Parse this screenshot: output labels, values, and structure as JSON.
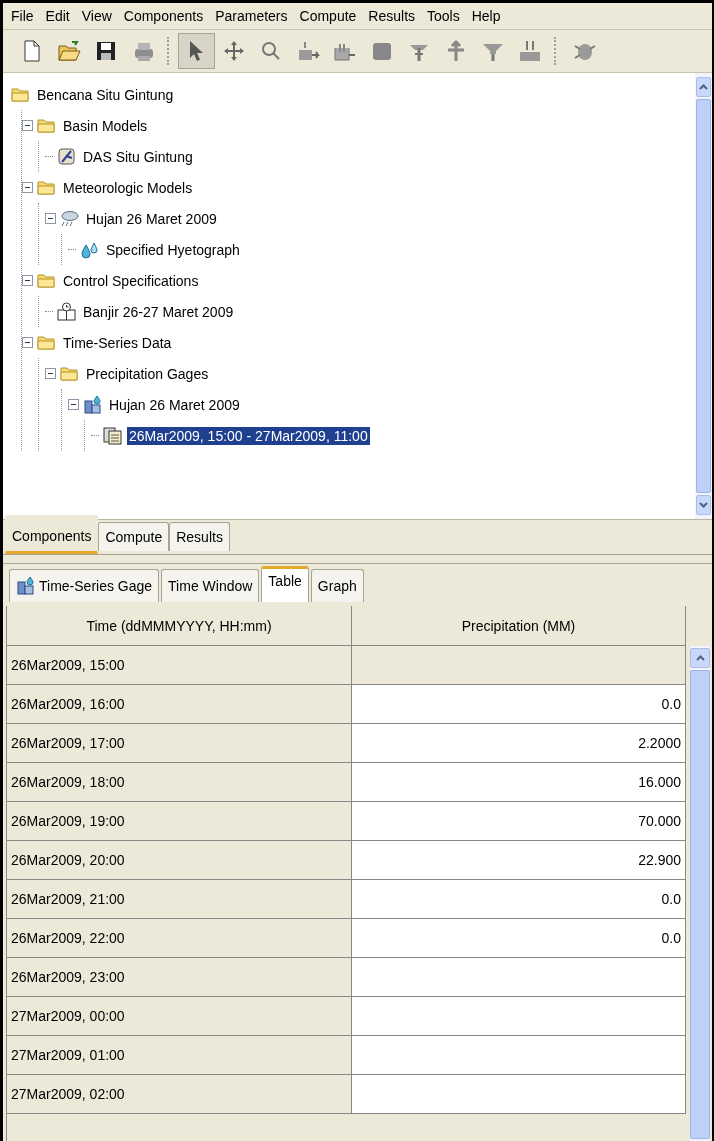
{
  "menu": [
    "File",
    "Edit",
    "View",
    "Components",
    "Parameters",
    "Compute",
    "Results",
    "Tools",
    "Help"
  ],
  "toolbar": {
    "groups": [
      [
        {
          "kind": "new",
          "selected": false
        },
        {
          "kind": "open",
          "selected": false
        },
        {
          "kind": "save",
          "selected": false
        },
        {
          "kind": "print",
          "selected": false
        }
      ],
      [
        {
          "kind": "select",
          "selected": true
        },
        {
          "kind": "move",
          "selected": false
        },
        {
          "kind": "zoom",
          "selected": false
        },
        {
          "kind": "source",
          "selected": false
        },
        {
          "kind": "inflow",
          "selected": false
        },
        {
          "kind": "reservoir",
          "selected": false
        },
        {
          "kind": "split",
          "selected": false
        },
        {
          "kind": "diversion",
          "selected": false
        },
        {
          "kind": "funnel",
          "selected": false
        },
        {
          "kind": "sink",
          "selected": false
        }
      ],
      [
        {
          "kind": "bug",
          "selected": false
        }
      ]
    ]
  },
  "tree": {
    "label": "Bencana Situ Gintung",
    "kind": "folder",
    "selected": false,
    "children": [
      {
        "label": "Basin Models",
        "kind": "folder",
        "expanded": true,
        "selected": false,
        "children": [
          {
            "label": "DAS Situ Gintung",
            "kind": "basin",
            "selected": false
          }
        ]
      },
      {
        "label": "Meteorologic Models",
        "kind": "folder",
        "expanded": true,
        "selected": false,
        "children": [
          {
            "label": "Hujan 26 Maret 2009",
            "kind": "rain",
            "expanded": true,
            "selected": false,
            "children": [
              {
                "label": "Specified Hyetograph",
                "kind": "drops",
                "selected": false
              }
            ]
          }
        ]
      },
      {
        "label": "Control Specifications",
        "kind": "folder",
        "expanded": true,
        "selected": false,
        "children": [
          {
            "label": "Banjir 26-27 Maret 2009",
            "kind": "calendar",
            "selected": false
          }
        ]
      },
      {
        "label": "Time-Series Data",
        "kind": "folder",
        "expanded": true,
        "selected": false,
        "children": [
          {
            "label": "Precipitation Gages",
            "kind": "folder",
            "expanded": true,
            "selected": false,
            "children": [
              {
                "label": "Hujan 26 Maret 2009",
                "kind": "gage",
                "expanded": true,
                "selected": false,
                "children": [
                  {
                    "label": "26Mar2009, 15:00 - 27Mar2009, 11:00",
                    "kind": "sheet",
                    "selected": true
                  }
                ]
              }
            ]
          }
        ]
      }
    ]
  },
  "main_tabs": [
    {
      "label": "Components",
      "selected": true
    },
    {
      "label": "Compute",
      "selected": false
    },
    {
      "label": "Results",
      "selected": false
    }
  ],
  "sub_tabs": [
    {
      "label": "Time-Series Gage",
      "kind": "gage",
      "selected": false
    },
    {
      "label": "Time Window",
      "selected": false
    },
    {
      "label": "Table",
      "selected": true
    },
    {
      "label": "Graph",
      "selected": false
    }
  ],
  "table": {
    "columns": [
      "Time (ddMMMYYYY, HH:mm)",
      "Precipitation (MM)"
    ],
    "rows": [
      {
        "time": "26Mar2009, 15:00",
        "editable": false
      },
      {
        "time": "26Mar2009, 16:00",
        "value": "0.0",
        "editable": true
      },
      {
        "time": "26Mar2009, 17:00",
        "value": "2.2000",
        "editable": true
      },
      {
        "time": "26Mar2009, 18:00",
        "value": "16.000",
        "editable": true
      },
      {
        "time": "26Mar2009, 19:00",
        "value": "70.000",
        "editable": true
      },
      {
        "time": "26Mar2009, 20:00",
        "value": "22.900",
        "editable": true
      },
      {
        "time": "26Mar2009, 21:00",
        "value": "0.0",
        "editable": true
      },
      {
        "time": "26Mar2009, 22:00",
        "value": "0.0",
        "editable": true
      },
      {
        "time": "26Mar2009, 23:00",
        "editable": true
      },
      {
        "time": "27Mar2009, 00:00",
        "editable": true
      },
      {
        "time": "27Mar2009, 01:00",
        "editable": true
      },
      {
        "time": "27Mar2009, 02:00",
        "editable": true
      }
    ]
  }
}
